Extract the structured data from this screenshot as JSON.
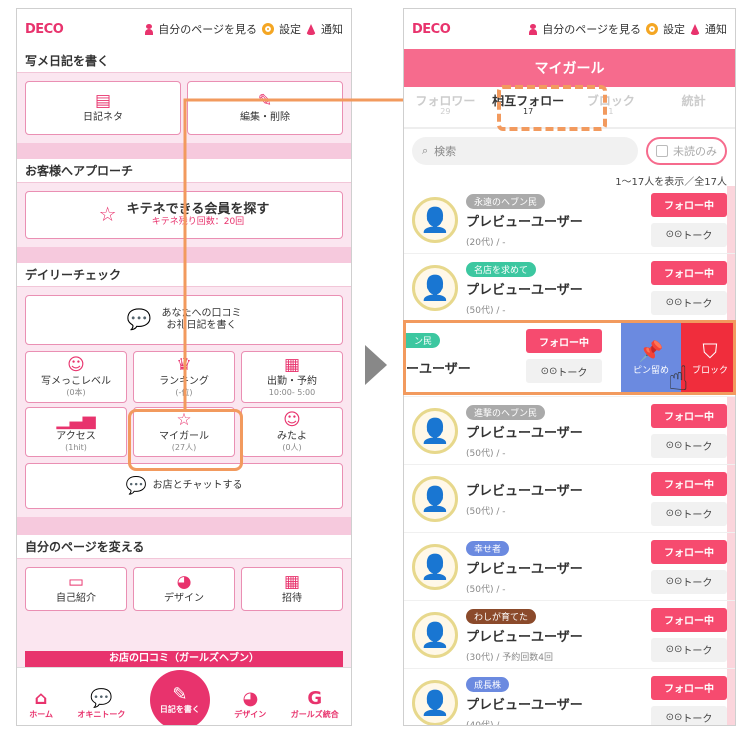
{
  "left": {
    "logo": "DECO",
    "top_links": {
      "mypage": "自分のページを見る",
      "settings": "設定",
      "notify": "通知"
    },
    "sec_diary": "写メ日記を書く",
    "diary_btns": [
      "日記ネタ",
      "編集・削除"
    ],
    "sec_approach": "お客様へアプローチ",
    "kitene_title": "キテネできる会員を探す",
    "kitene_sub": "キテネ残り回数：20回",
    "sec_daily": "デイリーチェック",
    "kuchikomi_l1": "あなたへの口コミ",
    "kuchikomi_l2": "お礼日記を書く",
    "grid": [
      {
        "label": "写メっこレベル",
        "sub": "(0本)"
      },
      {
        "label": "ランキング",
        "sub": "(-位)"
      },
      {
        "label": "出勤・予約",
        "sub": "10:00- 5:00"
      },
      {
        "label": "アクセス",
        "sub": "(1hit)"
      },
      {
        "label": "マイガール",
        "sub": "(27人)"
      },
      {
        "label": "みたよ",
        "sub": "(0人)"
      }
    ],
    "chat": "お店とチャットする",
    "sec_change": "自分のページを変える",
    "change_btns": [
      "自己紹介",
      "デザイン",
      "招待"
    ],
    "review_banner": "お店の口コミ（ガールズヘブン）",
    "nav": [
      "ホーム",
      "オキニトーク",
      "日記を書く",
      "デザイン",
      "ガールズ統合"
    ]
  },
  "right": {
    "title": "マイガール",
    "tabs": [
      {
        "label": "フォロワー",
        "count": "29"
      },
      {
        "label": "相互フォロー",
        "count": "17"
      },
      {
        "label": "ブロック",
        "count": "1"
      },
      {
        "label": "統計",
        "count": ""
      }
    ],
    "search_placeholder": "検索",
    "unread": "未読のみ",
    "count_text": "1〜17人を表示／全17人",
    "follow": "フォロー中",
    "talk": "トーク",
    "pin": "ピン留め",
    "block": "ブロック",
    "swipe_tag": "ン民",
    "swipe_name": "ーユーザー",
    "users": [
      {
        "tag": "永遠のヘブン民",
        "name": "プレビューユーザー",
        "meta": "(20代) / -",
        "tagcolor": "#aaaaaa"
      },
      {
        "tag": "名店を求めて",
        "name": "プレビューユーザー",
        "meta": "(50代) / -",
        "tagcolor": "#3cc7a0"
      },
      {
        "tag": "進撃のヘブン民",
        "name": "プレビューユーザー",
        "meta": "(50代) / -",
        "tagcolor": "#aaaaaa"
      },
      {
        "tag": "",
        "name": "プレビューユーザー",
        "meta": "(50代) / -",
        "tagcolor": "#aaaaaa"
      },
      {
        "tag": "幸せ者",
        "name": "プレビューユーザー",
        "meta": "(50代) / -",
        "tagcolor": "#6b8ae0"
      },
      {
        "tag": "わしが育てた",
        "name": "プレビューユーザー",
        "meta": "(30代) / 予約回数4回",
        "tagcolor": "#8b4a2b"
      },
      {
        "tag": "成長株",
        "name": "プレビューユーザー",
        "meta": "(40代) / -",
        "tagcolor": "#6b8ae0"
      }
    ]
  }
}
